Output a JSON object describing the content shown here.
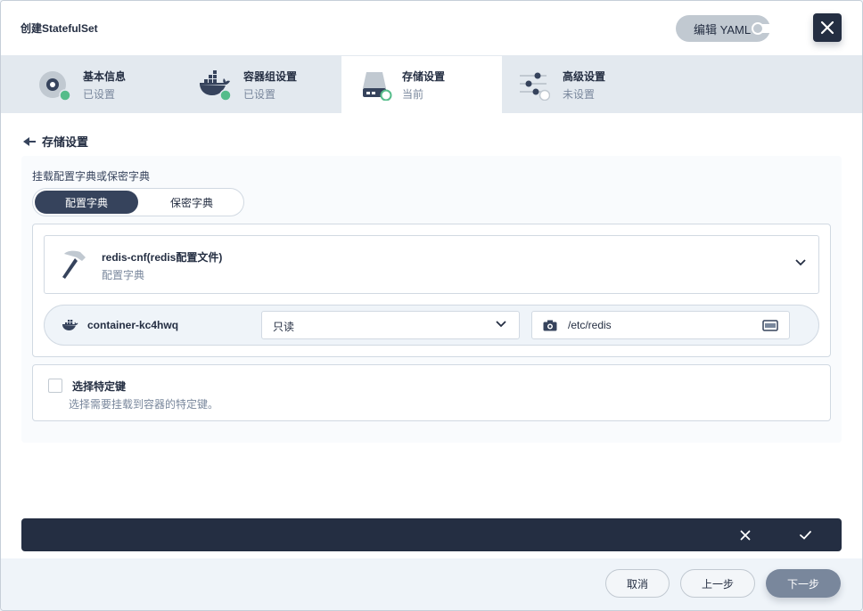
{
  "header": {
    "title": "创建StatefulSet",
    "yaml_label": "编辑 YAML"
  },
  "steps": [
    {
      "name": "基本信息",
      "status": "已设置"
    },
    {
      "name": "容器组设置",
      "status": "已设置"
    },
    {
      "name": "存储设置",
      "status": "当前"
    },
    {
      "name": "高级设置",
      "status": "未设置"
    }
  ],
  "section": {
    "title": "存储设置",
    "mount_label": "挂载配置字典或保密字典",
    "segments": [
      "配置字典",
      "保密字典"
    ],
    "configmap": {
      "name": "redis-cnf(redis配置文件)",
      "type": "配置字典"
    },
    "mount": {
      "container": "container-kc4hwq",
      "mode": "只读",
      "path": "/etc/redis"
    },
    "keys": {
      "label": "选择特定键",
      "desc": "选择需要挂载到容器的特定键。"
    }
  },
  "footer": {
    "cancel": "取消",
    "prev": "上一步",
    "next": "下一步"
  },
  "colors": {
    "primary_dark": "#242e42",
    "success": "#55bc8a",
    "bg": "#eff4f9"
  }
}
